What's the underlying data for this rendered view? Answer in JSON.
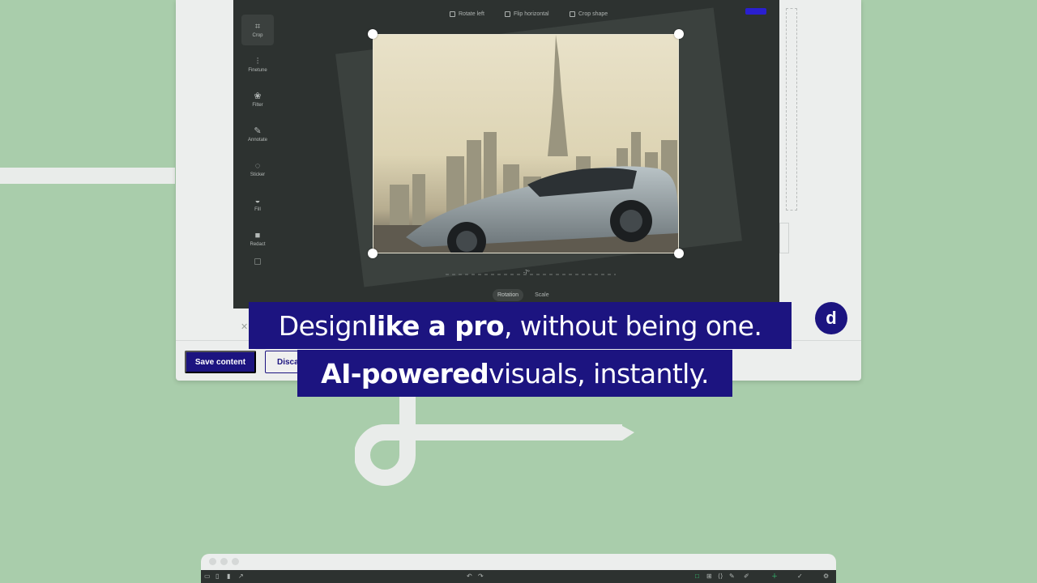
{
  "editor": {
    "top_actions": [
      {
        "label": "Rotate left",
        "icon": "rotate-left-icon"
      },
      {
        "label": "Flip horizontal",
        "icon": "flip-horizontal-icon"
      },
      {
        "label": "Crop shape",
        "icon": "crop-shape-icon"
      }
    ],
    "tools": [
      {
        "label": "Crop",
        "icon": "crop-icon",
        "active": true
      },
      {
        "label": "Finetune",
        "icon": "finetune-icon"
      },
      {
        "label": "Filter",
        "icon": "filter-icon"
      },
      {
        "label": "Annotate",
        "icon": "annotate-icon"
      },
      {
        "label": "Sticker",
        "icon": "sticker-icon"
      },
      {
        "label": "Fill",
        "icon": "fill-icon"
      },
      {
        "label": "Redact",
        "icon": "redact-icon"
      }
    ],
    "rotation_value": "-7°",
    "rotation_degrees": -7,
    "modes": [
      {
        "label": "Rotation",
        "active": true
      },
      {
        "label": "Scale",
        "active": false
      }
    ]
  },
  "cms": {
    "save_label": "Save content",
    "discard_label": "Disca"
  },
  "captions": {
    "line1": {
      "pre": "Design ",
      "bold": "like a pro",
      "post": ", without being one."
    },
    "line2": {
      "bold": "AI-powered",
      "post": " visuals, instantly."
    }
  },
  "brand": {
    "glyph": "d"
  },
  "colors": {
    "background": "#a9cdab",
    "caption_bg": "#1c1480",
    "editor_bg": "#2d3230",
    "accent_green": "#36d27a"
  }
}
